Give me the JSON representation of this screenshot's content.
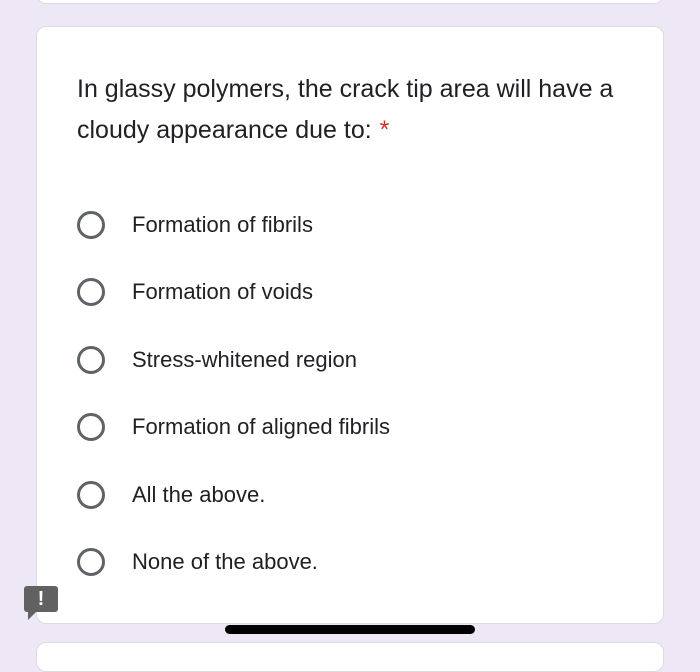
{
  "question": {
    "text": "In glassy polymers, the crack tip area will have a cloudy appearance due to:",
    "required_marker": "*"
  },
  "options": [
    {
      "label": "Formation of fibrils",
      "selected": false
    },
    {
      "label": "Formation of voids",
      "selected": false
    },
    {
      "label": "Stress-whitened region",
      "selected": false
    },
    {
      "label": "Formation of aligned fibrils",
      "selected": false
    },
    {
      "label": "All the above.",
      "selected": false
    },
    {
      "label": "None of the above.",
      "selected": false
    }
  ],
  "report_icon": {
    "icon": "report-problem-icon",
    "glyph": "!"
  },
  "colors": {
    "background": "#ede7f6",
    "card": "#ffffff",
    "required": "#d93025",
    "radio_border": "#5f6368",
    "text": "#202124"
  }
}
